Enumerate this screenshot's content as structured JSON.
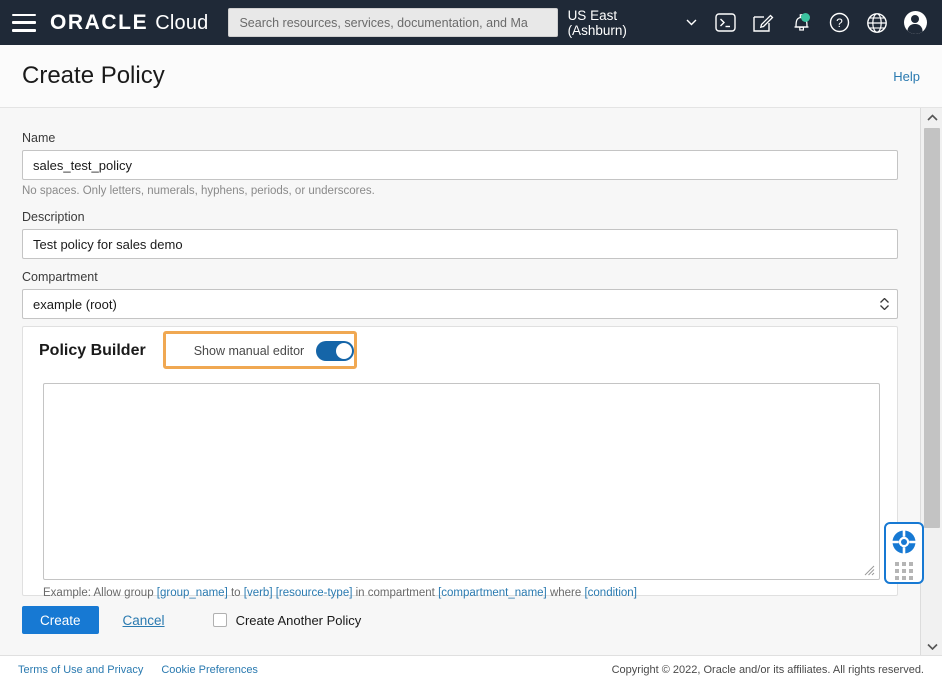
{
  "topbar": {
    "menu_icon": "hamburger-menu-icon",
    "brand_oracle": "ORACLE",
    "brand_cloud": "Cloud",
    "search": {
      "placeholder": "Search resources, services, documentation, and Ma",
      "value": ""
    },
    "region": "US East (Ashburn)",
    "icons": [
      "cloud-shell-icon",
      "edit-pencil-icon",
      "notifications-bell-icon",
      "help-question-icon",
      "language-globe-icon",
      "user-avatar-icon"
    ],
    "background_color": "#1f2937"
  },
  "page": {
    "title": "Create Policy",
    "help_label": "Help"
  },
  "form": {
    "name": {
      "label": "Name",
      "value": "sales_test_policy",
      "placeholder": "",
      "hint": "No spaces. Only letters, numerals, hyphens, periods, or underscores."
    },
    "description": {
      "label": "Description",
      "value": "Test policy for sales demo",
      "placeholder": ""
    },
    "compartment": {
      "label": "Compartment",
      "value": "example (root)"
    }
  },
  "policy_builder": {
    "title": "Policy Builder",
    "toggle_label": "Show manual editor",
    "toggle_on": true,
    "toggle_color": "#1565a8",
    "editor_value": "",
    "editor_placeholder": "",
    "example_prefix": "Example: Allow group ",
    "example_group": "[group_name]",
    "example_to": " to ",
    "example_verb": "[verb]",
    "example_space1": " ",
    "example_resource": "[resource-type]",
    "example_in": " in compartment ",
    "example_compartment": "[compartment_name]",
    "example_where": " where ",
    "example_condition": "[condition]",
    "annotation_color": "#f0a852"
  },
  "actions": {
    "create_label": "Create",
    "cancel_label": "Cancel",
    "create_another_label": "Create Another Policy",
    "create_another_checked": false,
    "create_button_color": "#1779d3"
  },
  "footer": {
    "terms_label": "Terms of Use and Privacy",
    "cookie_label": "Cookie Preferences",
    "copyright": "Copyright © 2022, Oracle and/or its affiliates. All rights reserved."
  },
  "support_widget": {
    "icon": "lifebuoy-support-icon",
    "drag_handle": "drag-dots-handle"
  },
  "scrollbar": {
    "up_arrow": "scroll-up-arrow",
    "down_arrow": "scroll-down-arrow"
  }
}
